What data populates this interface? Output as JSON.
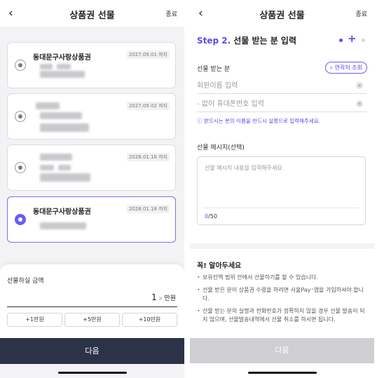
{
  "colors": {
    "accent": "#5b4de8",
    "dark_button": "#2c3248",
    "disabled_button": "#cfcfd3"
  },
  "left": {
    "header": {
      "back_icon": "chevron-left-icon",
      "title": "상품권 선물",
      "close": "종료"
    },
    "cards": [
      {
        "name": "동대문구사랑상품권",
        "expiry": "2027.09.01 까지",
        "selected": false
      },
      {
        "name": "",
        "expiry": "2027.09.02 까지",
        "selected": false
      },
      {
        "name": "",
        "expiry": "2028.01.18 까지",
        "selected": false
      },
      {
        "name": "동대문구사랑상품권",
        "expiry": "2028.01.18 까지",
        "selected": true
      }
    ],
    "amount_sheet": {
      "label": "선물하실 금액",
      "value": "1",
      "clear_symbol": "×",
      "unit": "만원",
      "chips": [
        "+1만원",
        "+5만원",
        "+10만원"
      ]
    },
    "next_button": "다음"
  },
  "right": {
    "header": {
      "back_icon": "chevron-left-icon",
      "title": "상품권 선물",
      "close": "종료"
    },
    "step": {
      "number": "Step 2.",
      "title": "선물 받는 분 입력"
    },
    "recipient": {
      "label": "선물 받는 분",
      "contact_button": "연락처 조회",
      "name_placeholder": "회원이름 입력",
      "phone_placeholder": "- 없이 휴대폰번호 입력",
      "notice": "받으시는 분의 이름을 반드시 실명으로 입력해주세요."
    },
    "message": {
      "label": "선물 메시지(선택)",
      "placeholder": "선물 메시지 내용을 입력해주세요.",
      "count_current": "0",
      "count_max": "/50"
    },
    "info": {
      "title": "꼭! 알아두세요",
      "items": [
        "보유잔액 범위 안에서 선물하기를 할 수 있습니다.",
        "선물 받은 분이 상품권 수령을 하려면 서울Pay⁺앱을 가입하셔야 합니다.",
        "선물 받는 분의 실명과 전화번호가 정확하지 않을 경우 선물 발송이 되지 않으며, 선물발송내역에서 선물 취소를 하시면 됩니다."
      ]
    },
    "next_button": "다음"
  }
}
